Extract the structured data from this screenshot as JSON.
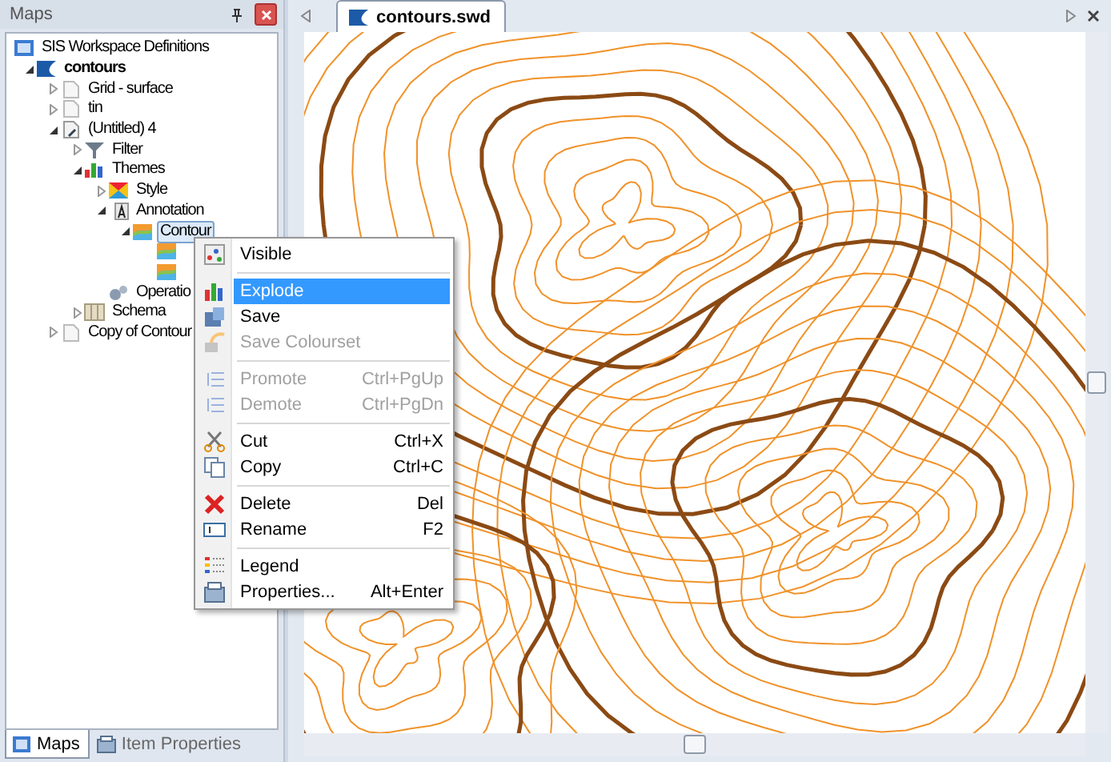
{
  "panel": {
    "title": "Maps"
  },
  "tree": {
    "label": "SIS Workspace Definitions",
    "kind": "workspace",
    "selected": false,
    "children": [
      {
        "label": "contours",
        "kind": "map",
        "expanded": true,
        "selected": false,
        "children": [
          {
            "label": "Grid - surface",
            "kind": "dataset",
            "expanded": false,
            "selected": false
          },
          {
            "label": "tin",
            "kind": "dataset",
            "expanded": false,
            "selected": false
          },
          {
            "label": "(Untitled) 4",
            "kind": "dataset-edit",
            "expanded": true,
            "selected": false,
            "children": [
              {
                "label": "Filter",
                "kind": "filter",
                "expanded": false,
                "selected": false
              },
              {
                "label": "Themes",
                "kind": "themes",
                "expanded": true,
                "selected": false,
                "children": [
                  {
                    "label": "Style",
                    "kind": "style",
                    "expanded": false,
                    "selected": false
                  },
                  {
                    "label": "Annotation",
                    "kind": "annotation",
                    "expanded": true,
                    "selected": false,
                    "children": [
                      {
                        "label": "Contour",
                        "kind": "contour",
                        "expanded": true,
                        "selected": true,
                        "children": [
                          {
                            "kind": "contour",
                            "selected": false
                          },
                          {
                            "kind": "contour",
                            "selected": false
                          }
                        ]
                      }
                    ]
                  },
                  {
                    "label": "Operatio",
                    "kind": "operations",
                    "selected": false
                  }
                ]
              },
              {
                "label": "Schema",
                "kind": "schema",
                "expanded": false,
                "selected": false
              }
            ]
          },
          {
            "label": "Copy of Contour",
            "kind": "dataset",
            "expanded": false,
            "selected": false
          }
        ]
      }
    ]
  },
  "panel_tabs": [
    {
      "label": "Maps",
      "selected": true
    },
    {
      "label": "Item Properties",
      "selected": false
    }
  ],
  "document_tab": {
    "label": "contours.swd",
    "selected": true
  },
  "context_menu": [
    {
      "kind": "item",
      "label": "Visible",
      "disabled": false,
      "selected": false
    },
    {
      "kind": "separator"
    },
    {
      "kind": "item",
      "label": "Explode",
      "disabled": false,
      "selected": true
    },
    {
      "kind": "item",
      "label": "Save",
      "disabled": false,
      "selected": false
    },
    {
      "kind": "item",
      "label": "Save Colourset",
      "disabled": true,
      "selected": false
    },
    {
      "kind": "separator"
    },
    {
      "kind": "item",
      "label": "Promote",
      "shortcut": "Ctrl+PgUp",
      "disabled": true,
      "selected": false
    },
    {
      "kind": "item",
      "label": "Demote",
      "shortcut": "Ctrl+PgDn",
      "disabled": true,
      "selected": false
    },
    {
      "kind": "separator"
    },
    {
      "kind": "item",
      "label": "Cut",
      "shortcut": "Ctrl+X",
      "disabled": false,
      "selected": false
    },
    {
      "kind": "item",
      "label": "Copy",
      "shortcut": "Ctrl+C",
      "disabled": false,
      "selected": false
    },
    {
      "kind": "separator"
    },
    {
      "kind": "item",
      "label": "Delete",
      "shortcut": "Del",
      "disabled": false,
      "selected": false
    },
    {
      "kind": "item",
      "label": "Rename",
      "shortcut": "F2",
      "disabled": false,
      "selected": false
    },
    {
      "kind": "separator"
    },
    {
      "kind": "item",
      "label": "Legend",
      "disabled": false,
      "selected": false
    },
    {
      "kind": "item",
      "label": "Properties...",
      "shortcut": "Alt+Enter",
      "disabled": false,
      "selected": false
    }
  ]
}
